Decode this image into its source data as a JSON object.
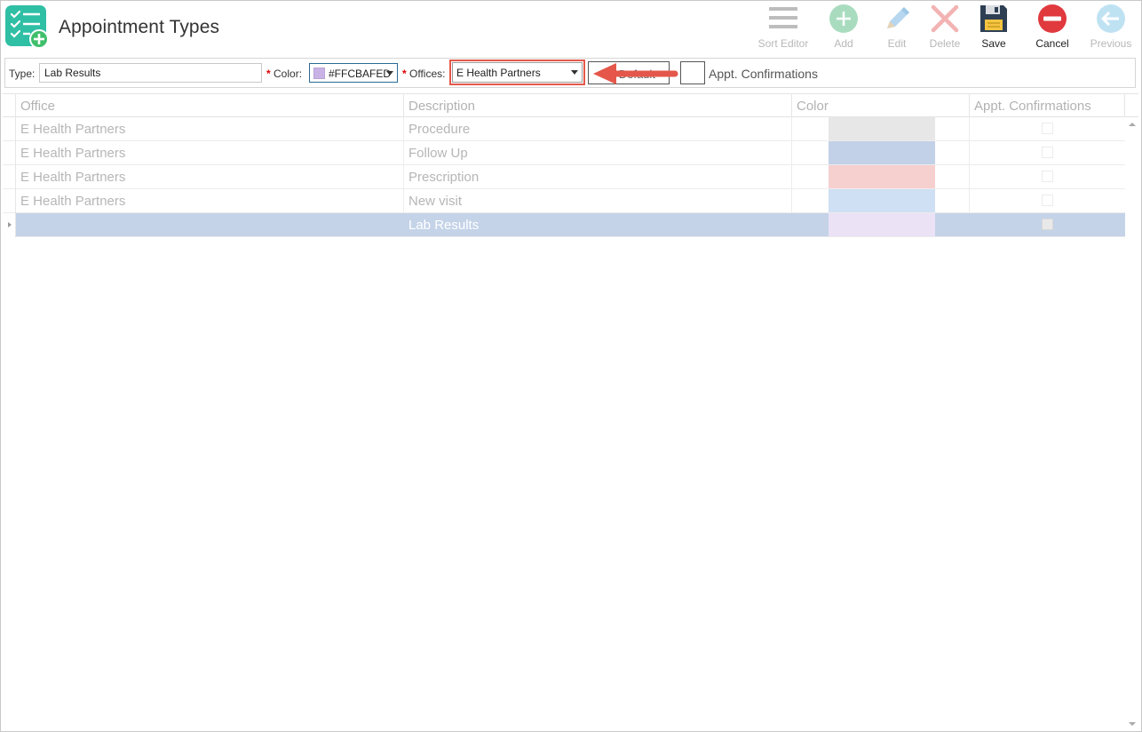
{
  "header": {
    "title": "Appointment Types"
  },
  "toolbar": {
    "sort_editor": "Sort Editor",
    "add": "Add",
    "edit": "Edit",
    "delete": "Delete",
    "save": "Save",
    "cancel": "Cancel",
    "previous": "Previous"
  },
  "form": {
    "type_label": "Type:",
    "type_value": "Lab Results",
    "color_label": "Color:",
    "color_value": "#FFCBAFED",
    "offices_label": "Offices:",
    "offices_value": "E Health Partners",
    "hidden_text": "Is Default",
    "confirmations_label": "Appt. Confirmations",
    "required_marker": "*"
  },
  "grid": {
    "columns": [
      "Office",
      "Description",
      "Color",
      "Appt. Confirmations"
    ],
    "rows": [
      {
        "office": "E Health Partners",
        "description": "Procedure",
        "color": "#e7e7e7",
        "confirm": false
      },
      {
        "office": "E Health Partners",
        "description": "Follow Up",
        "color": "#c2d1e8",
        "confirm": false
      },
      {
        "office": "E Health Partners",
        "description": "Prescription",
        "color": "#f6cfcf",
        "confirm": false
      },
      {
        "office": "E Health Partners",
        "description": "New visit",
        "color": "#cfdff4",
        "confirm": false
      },
      {
        "office": "",
        "description": "Lab Results",
        "color": "#ebe2f6",
        "confirm": false,
        "selected": true
      }
    ]
  },
  "colors": {
    "accent_red": "#e4574a",
    "selected_row": "#c4d3e8",
    "app_icon": "#2fbfa5"
  }
}
